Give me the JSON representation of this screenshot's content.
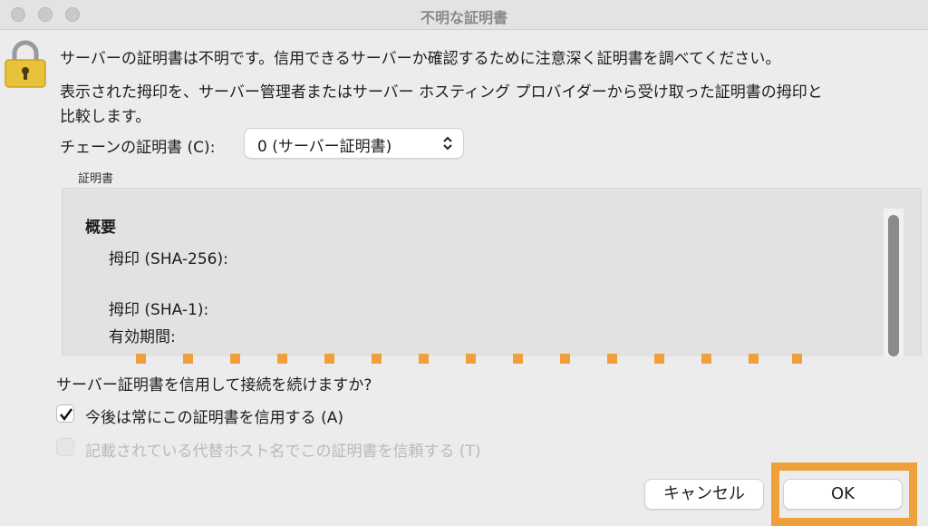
{
  "window": {
    "title": "不明な証明書"
  },
  "message": {
    "line1": "サーバーの証明書は不明です。信用できるサーバーか確認するために注意深く証明書を調べてください。",
    "line2": "表示された拇印を、サーバー管理者またはサーバー ホスティング プロバイダーから受け取った証明書の拇印と",
    "line3": "比較します。"
  },
  "chain": {
    "label": "チェーンの証明書 (C):",
    "selected": "0 (サーバー証明書)"
  },
  "certificate": {
    "group_label": "証明書",
    "section_title": "概要",
    "fields": [
      {
        "label": "拇印 (SHA-256):"
      },
      {
        "label": "拇印 (SHA-1):"
      },
      {
        "label": "有効期間:"
      }
    ]
  },
  "trust": {
    "question": "サーバー証明書を信用して接続を続けますか?",
    "always_trust_label": "今後は常にこの証明書を信用する (A)",
    "always_trust_checked": true,
    "alt_hosts_label": "記載されている代替ホスト名でこの証明書を信頼する (T)",
    "alt_hosts_checked": false,
    "alt_hosts_enabled": false
  },
  "buttons": {
    "cancel": "キャンセル",
    "ok": "OK"
  },
  "colors": {
    "highlight": "#f0a03a",
    "lock_body": "#e8c23a"
  }
}
